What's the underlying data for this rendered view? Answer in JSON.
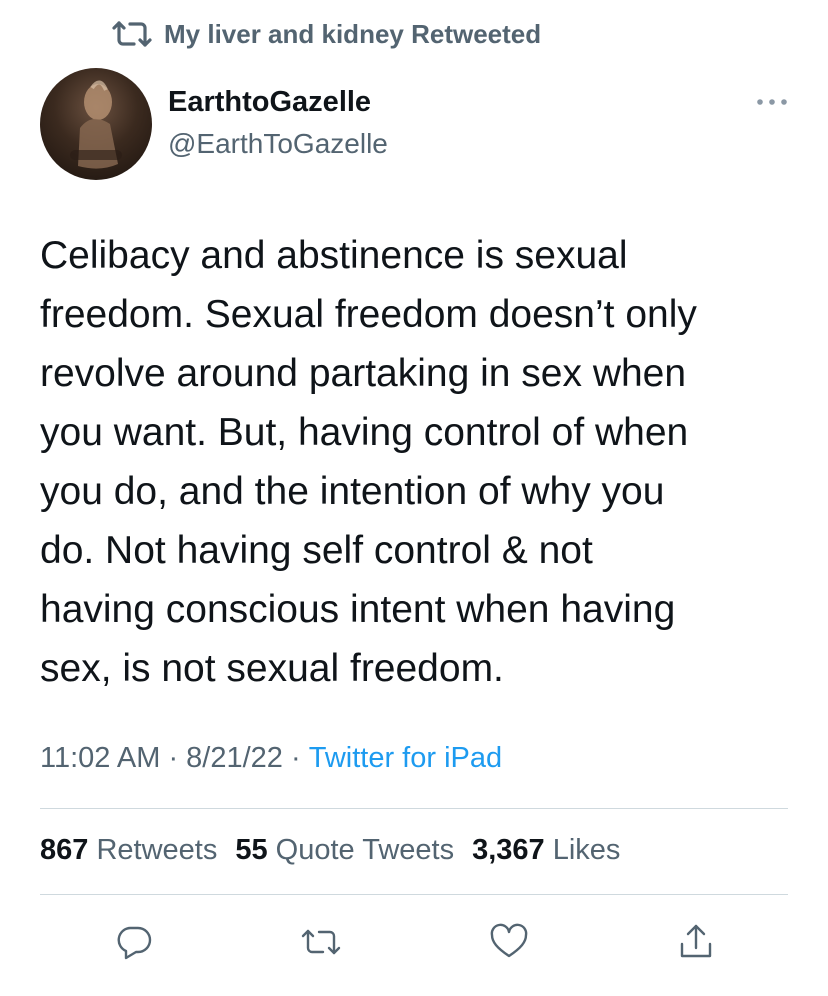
{
  "retweet_context": {
    "text": "My liver and kidney Retweeted"
  },
  "author": {
    "display_name": "EarthtoGazelle",
    "handle": "@EarthToGazelle"
  },
  "tweet": {
    "text": "Celibacy and abstinence is sexual\nfreedom. Sexual freedom doesn’t only\nrevolve around partaking in sex when\nyou want. But, having control of when\nyou do, and the intention of why you\ndo. Not having self control & not\nhaving conscious intent when having\nsex, is not sexual freedom.",
    "time": "11:02 AM",
    "separator1": " · ",
    "date": "8/21/22",
    "separator2": " · ",
    "source": "Twitter for iPad"
  },
  "stats": {
    "retweets_count": "867",
    "retweets_label": "Retweets",
    "quotes_count": "55",
    "quotes_label": "Quote Tweets",
    "likes_count": "3,367",
    "likes_label": "Likes"
  },
  "icons": {
    "retweet_context": "retweet-icon",
    "more": "more-icon",
    "reply": "reply-icon",
    "retweet": "retweet-icon",
    "like": "heart-icon",
    "share": "share-icon"
  },
  "colors": {
    "text": "#0f1419",
    "secondary": "#536471",
    "link": "#1d9bf0",
    "divider": "#cfd9de"
  }
}
